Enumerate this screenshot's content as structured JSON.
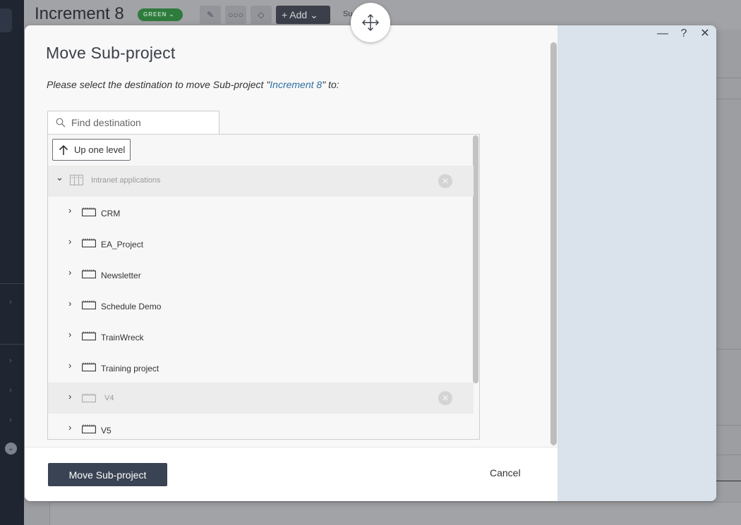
{
  "background": {
    "title": "Increment 8",
    "badge": "GREEN ⌄",
    "add_label": "+ Add ⌄",
    "sum_label": "Su"
  },
  "dialog": {
    "title": "Move Sub-project",
    "description_prefix": "Please select the destination to move Sub-project \"",
    "description_link": "Increment 8",
    "description_suffix": "\" to:",
    "search_placeholder": "Find destination",
    "up_label": "Up one level",
    "root": {
      "label": "Intranet applications"
    },
    "items": [
      {
        "label": "CRM"
      },
      {
        "label": "EA_Project"
      },
      {
        "label": "Newsletter"
      },
      {
        "label": "Schedule Demo"
      },
      {
        "label": "TrainWreck"
      },
      {
        "label": "Training project"
      },
      {
        "label": "V4"
      },
      {
        "label": "V5"
      }
    ],
    "primary_button": "Move Sub-project",
    "cancel_button": "Cancel"
  },
  "window_controls": {
    "minimize": "—",
    "help": "?",
    "close": "✕"
  },
  "colors": {
    "primary": "#3a4353",
    "link": "#2d6fa4",
    "side_panel": "#dae2ec"
  }
}
